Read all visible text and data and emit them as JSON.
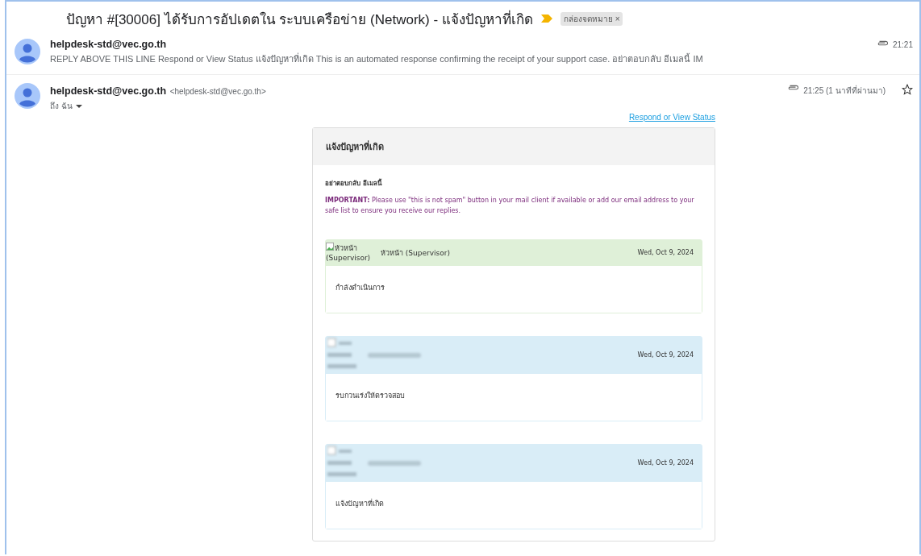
{
  "subject": "ปัญหา #[30006] ได้รับการอัปเดตใน ระบบเครือข่าย (Network) - แจ้งปัญหาที่เกิด",
  "important": true,
  "label": {
    "text": "กล่องจดหมาย",
    "close": "×"
  },
  "collapsed_message": {
    "sender": "helpdesk-std@vec.go.th",
    "snippet": "REPLY ABOVE THIS LINE Respond or View Status แจ้งปัญหาที่เกิด This is an automated response confirming the receipt of your support case. อย่าตอบกลับ อีเมลนี้ IM",
    "time": "21:21",
    "has_attachment": true
  },
  "open_message": {
    "sender": "helpdesk-std@vec.go.th",
    "sender_address": "<helpdesk-std@vec.go.th>",
    "recipient": "ถึง ฉัน",
    "time": "21:25 (1 นาทีที่ผ่านมา)",
    "has_attachment": true,
    "starred": false,
    "link": "Respond or View Status",
    "card": {
      "title": "แจ้งปัญหาที่เกิด",
      "notice": "อย่าตอบกลับ อีเมลนี้",
      "important": "**IMPORTANT:** Please use \"this is not spam\" button in your mail client if available or add our email address to your safe list to ensure you receive our replies.",
      "entries": [
        {
          "color": "#dff0d8",
          "redacted": false,
          "avatar_alt": "หัวหน้า (Supervisor)",
          "name": "หัวหน้า (Supervisor)",
          "date": "Wed, Oct 9, 2024",
          "body": "กำลังดำเนินการ"
        },
        {
          "color": "#d9edf7",
          "redacted": true,
          "date": "Wed, Oct 9, 2024",
          "body": "รบกวนเร่งให้ตรวจสอบ"
        },
        {
          "color": "#d9edf7",
          "redacted": true,
          "date": "Wed, Oct 9, 2024",
          "body": "แจ้งปัญหาที่เกิด"
        }
      ]
    }
  }
}
